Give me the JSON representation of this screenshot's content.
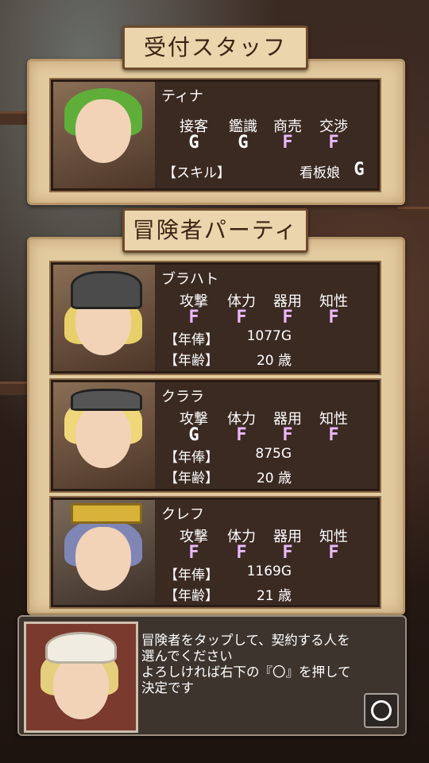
{
  "reception": {
    "title": "受付スタッフ",
    "staff": {
      "name": "ティナ",
      "stats": [
        "接客",
        "鑑識",
        "商売",
        "交渉"
      ],
      "grades": [
        "G",
        "G",
        "F",
        "F"
      ],
      "skill_label": "【スキル】",
      "skill_value": "看板娘",
      "skill_grade": "G"
    }
  },
  "party": {
    "title": "冒険者パーティ",
    "stat_headers": [
      "攻撃",
      "体力",
      "器用",
      "知性"
    ],
    "salary_label": "【年俸】",
    "age_label": "【年齢】",
    "members": [
      {
        "name": "ブラハト",
        "grades": [
          "F",
          "F",
          "F",
          "F"
        ],
        "salary": "1077G",
        "age": "20 歳"
      },
      {
        "name": "クララ",
        "grades": [
          "G",
          "F",
          "F",
          "F"
        ],
        "salary": "875G",
        "age": "20 歳"
      },
      {
        "name": "クレフ",
        "grades": [
          "F",
          "F",
          "F",
          "F"
        ],
        "salary": "1169G",
        "age": "21 歳"
      }
    ]
  },
  "message": {
    "lines": [
      "冒険者をタップして、契約する人を",
      "選んでください",
      "よろしければ右下の『〇』を押して",
      "決定です"
    ]
  },
  "colors": {
    "grade_F": "#e9b8ff",
    "grade_G": "#ffffff",
    "parchment": "#e3cba0"
  }
}
